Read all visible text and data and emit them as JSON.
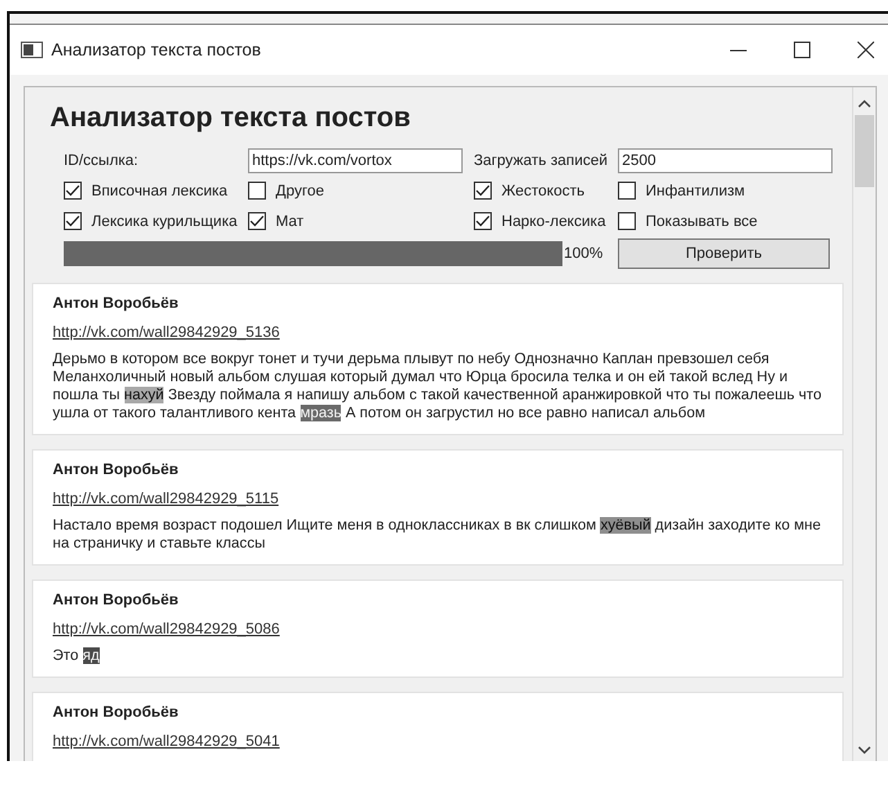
{
  "window": {
    "title": "Анализатор текста постов"
  },
  "heading": "Анализатор текста постов",
  "form": {
    "id_label": "ID/ссылка:",
    "id_value": "https://vk.com/vortox",
    "count_label": "Загружать записей",
    "count_value": "2500",
    "options": [
      {
        "label": "Вписочная лексика",
        "checked": true
      },
      {
        "label": "Другое",
        "checked": false
      },
      {
        "label": "Жестокость",
        "checked": true
      },
      {
        "label": "Инфантилизм",
        "checked": false
      },
      {
        "label": "Лексика курильщика",
        "checked": true
      },
      {
        "label": "Мат",
        "checked": true
      },
      {
        "label": "Нарко-лексика",
        "checked": true
      },
      {
        "label": "Показывать все",
        "checked": false
      }
    ],
    "progress": {
      "level": 1,
      "reading": "100%"
    },
    "check_button": "Проверить"
  },
  "posts": [
    {
      "author": "Антон Воробьёв",
      "link": "http://vk.com/wall29842929_5136",
      "body": [
        {
          "text": "Дерьмо в котором все вокруг тонет и тучи дерьма плывут по небу Однозначно Каплан превзошел себя Меланхоличный новый альбом слушая который думал что Юрца бросила телка и он ей такой вслед Ну и пошла ты "
        },
        {
          "text": "нахуй",
          "color": "#a8a8a8"
        },
        {
          "text": " Звезду поймала я напишу альбом с такой качественной аранжировкой что ты пожалеешь что ушла от такого талантливого кента "
        },
        {
          "text": "мразь",
          "color": "#6a6a6a"
        },
        {
          "text": " А потом он загрустил но все равно написал альбом"
        }
      ]
    },
    {
      "author": "Антон Воробьёв",
      "link": "http://vk.com/wall29842929_5115",
      "body": [
        {
          "text": "Настало время возраст подошел Ищите меня в одноклассниках в вк слишком "
        },
        {
          "text": "хуёвый",
          "color": "#8e8e8e"
        },
        {
          "text": " дизайн заходите ко мне на страничку и ставьте классы"
        }
      ]
    },
    {
      "author": "Антон Воробьёв",
      "link": "http://vk.com/wall29842929_5086",
      "body": [
        {
          "text": "Это "
        },
        {
          "text": "яд",
          "color": "#4a4a4a"
        }
      ]
    },
    {
      "author": "Антон Воробьёв",
      "link": "http://vk.com/wall29842929_5041"
    }
  ]
}
